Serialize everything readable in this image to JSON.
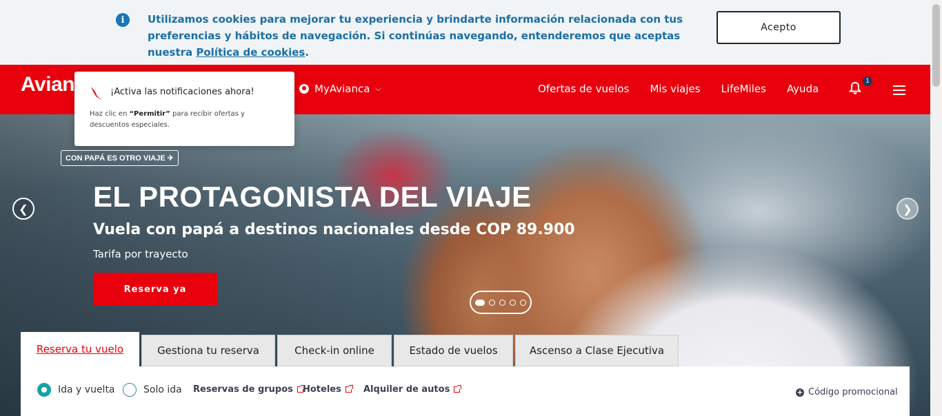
{
  "cookie_banner": {
    "icon": "info-icon",
    "text_before_link": "Utilizamos cookies para mejorar tu experiencia y brindarte información relacionada con tus preferencias y hábitos de navegación. Si continúas navegando, entenderemos que aceptas nuestra ",
    "link_text": "Política de cookies",
    "text_after_link": ".",
    "accept_label": "Acepto"
  },
  "header": {
    "logo_text": "Avian",
    "brand_color": "#e8000d",
    "myavianca_label": "MyAvianca",
    "nav": [
      "Ofertas de vuelos",
      "Mis viajes",
      "LifeMiles",
      "Ayuda"
    ],
    "notifications_count": "1"
  },
  "notification_popup": {
    "title": "¡Activa las notificaciones ahora!",
    "body_prefix": "Haz clic en ",
    "body_bold": "“Permitir”",
    "body_suffix": " para recibir ofertas y descuentos especiales."
  },
  "hero": {
    "tag": "CON PAPÁ ES OTRO VIAJE ✈",
    "headline": "EL PROTAGONISTA DEL VIAJE",
    "subheadline": "Vuela con papá a destinos nacionales desde COP 89.900",
    "fare_note": "Tarifa por trayecto",
    "cta_label": "Reserva ya",
    "slides": 5,
    "active_slide": 1
  },
  "booking": {
    "tabs": [
      "Reserva tu vuelo",
      "Gestiona tu reserva",
      "Check-in online",
      "Estado de vuelos",
      "Ascenso a Clase Ejecutiva"
    ],
    "active_tab": 0,
    "trip_types": [
      "Ida y vuelta",
      "Solo ida"
    ],
    "selected_trip_type": "Ida y vuelta",
    "links": [
      "Reservas de grupos",
      "Hoteles",
      "Alquiler de autos"
    ],
    "promo_label": "Código promocional"
  }
}
